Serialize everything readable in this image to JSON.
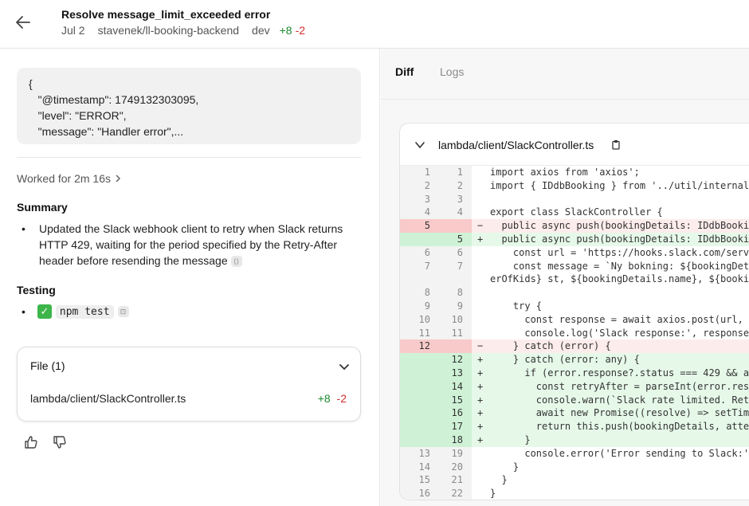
{
  "header": {
    "title": "Resolve message_limit_exceeded error",
    "date": "Jul 2",
    "repo": "stavenek/ll-booking-backend",
    "branch": "dev",
    "additions": "+8",
    "deletions": "-2"
  },
  "left": {
    "json_lines": [
      "{",
      "   \"@timestamp\": 1749132303095,",
      "   \"level\": \"ERROR\",",
      "   \"message\": \"Handler error\",..."
    ],
    "worked_for": "Worked for 2m 16s",
    "summary_title": "Summary",
    "summary_text": "Updated the Slack webhook client to retry when Slack returns HTTP 429, waiting for the period specified by the Retry-After header before resending the message",
    "testing_title": "Testing",
    "testing_check": "✓",
    "testing_command": "npm test",
    "file_card": {
      "title": "File (1)",
      "path": "lambda/client/SlackController.ts",
      "additions": "+8",
      "deletions": "-2"
    }
  },
  "right": {
    "tabs": [
      {
        "label": "Diff",
        "active": true
      },
      {
        "label": "Logs",
        "active": false
      }
    ],
    "diff_file": "lambda/client/SlackController.ts",
    "lines": [
      {
        "old": "1",
        "new": "1",
        "type": "ctx",
        "code": "import axios from 'axios';"
      },
      {
        "old": "2",
        "new": "2",
        "type": "ctx",
        "code": "import { IDdbBooking } from '../util/internal"
      },
      {
        "old": "3",
        "new": "3",
        "type": "ctx",
        "code": ""
      },
      {
        "old": "4",
        "new": "4",
        "type": "ctx",
        "code": "export class SlackController {"
      },
      {
        "old": "5",
        "new": "",
        "type": "del",
        "code": "  public async push(bookingDetails: IDdbBooki"
      },
      {
        "old": "",
        "new": "5",
        "type": "add",
        "code": "  public async push(bookingDetails: IDdbBooki"
      },
      {
        "old": "6",
        "new": "6",
        "type": "ctx",
        "code": "    const url = 'https://hooks.slack.com/serv"
      },
      {
        "old": "7",
        "new": "7",
        "type": "ctx",
        "code": "    const message = `Ny bokning: ${bookingDet",
        "code2": "erOfKids} st, ${bookingDetails.name}, ${booki"
      },
      {
        "old": "8",
        "new": "8",
        "type": "ctx",
        "code": ""
      },
      {
        "old": "9",
        "new": "9",
        "type": "ctx",
        "code": "    try {"
      },
      {
        "old": "10",
        "new": "10",
        "type": "ctx",
        "code": "      const response = await axios.post(url, "
      },
      {
        "old": "11",
        "new": "11",
        "type": "ctx",
        "code": "      console.log('Slack response:', response"
      },
      {
        "old": "12",
        "new": "",
        "type": "del",
        "code": "    } catch (error) {"
      },
      {
        "old": "",
        "new": "12",
        "type": "add",
        "code": "    } catch (error: any) {"
      },
      {
        "old": "",
        "new": "13",
        "type": "add",
        "code": "      if (error.response?.status === 429 && a"
      },
      {
        "old": "",
        "new": "14",
        "type": "add",
        "code": "        const retryAfter = parseInt(error.res"
      },
      {
        "old": "",
        "new": "15",
        "type": "add",
        "code": "        console.warn(`Slack rate limited. Ret"
      },
      {
        "old": "",
        "new": "16",
        "type": "add",
        "code": "        await new Promise((resolve) => setTim"
      },
      {
        "old": "",
        "new": "17",
        "type": "add",
        "code": "        return this.push(bookingDetails, atte"
      },
      {
        "old": "",
        "new": "18",
        "type": "add",
        "code": "      }"
      },
      {
        "old": "13",
        "new": "19",
        "type": "ctx",
        "code": "      console.error('Error sending to Slack:'"
      },
      {
        "old": "14",
        "new": "20",
        "type": "ctx",
        "code": "    }"
      },
      {
        "old": "15",
        "new": "21",
        "type": "ctx",
        "code": "  }"
      },
      {
        "old": "16",
        "new": "22",
        "type": "ctx",
        "code": "}"
      }
    ]
  },
  "colors": {
    "add_bg": "#e6f9e9",
    "del_bg": "#fdecec",
    "plus": "#1a8a2e",
    "minus": "#d12e2e"
  },
  "icons": [
    "back-arrow-icon",
    "chevron-right-icon",
    "chevron-down-icon",
    "copy-icon",
    "thumbs-up-icon",
    "thumbs-down-icon"
  ]
}
